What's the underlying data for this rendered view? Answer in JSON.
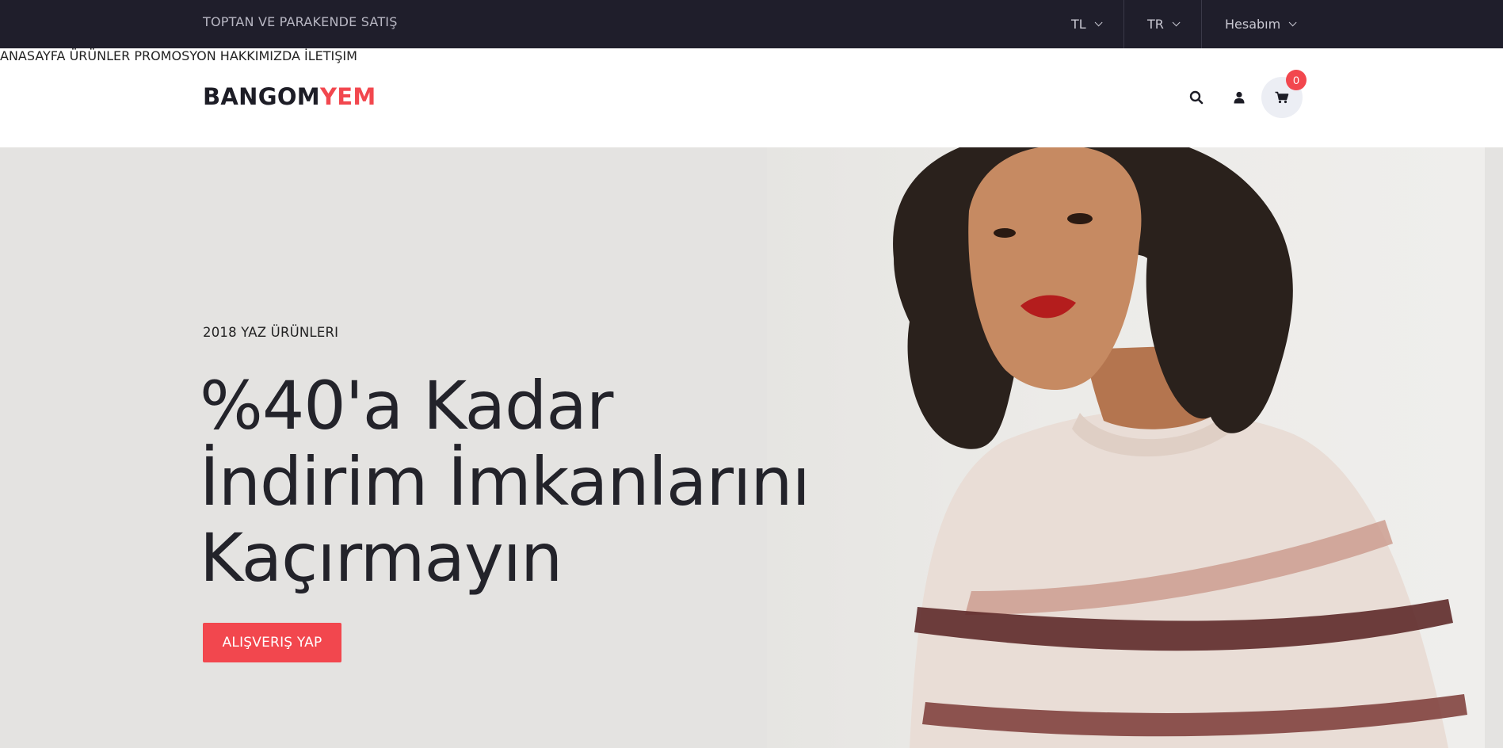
{
  "topbar": {
    "slogan": "TOPTAN VE PARAKENDE SATIŞ",
    "currency": "TL",
    "language": "TR",
    "account": "Hesabım"
  },
  "header": {
    "logo_part1": "BANGOM",
    "logo_part2": "YEM",
    "nav": [
      "ANASAYFA",
      "ÜRÜNLER",
      "PROMOSYON",
      "HAKKIMIZDA",
      "İLETIŞIM"
    ],
    "cart_count": "0",
    "icons": [
      "search-icon",
      "user-icon",
      "cart-icon"
    ]
  },
  "hero": {
    "eyebrow": "2018 YAZ ÜRÜNLERI",
    "headline": [
      "%40'a Kadar",
      "İndirim İmkanlarını",
      "Kaçırmayın"
    ],
    "cta_label": "ALIŞVERIŞ YAP"
  },
  "colors": {
    "accent": "#f2474e",
    "topbar_bg": "#1f1e2b",
    "hero_bg": "#e4e3e1"
  }
}
